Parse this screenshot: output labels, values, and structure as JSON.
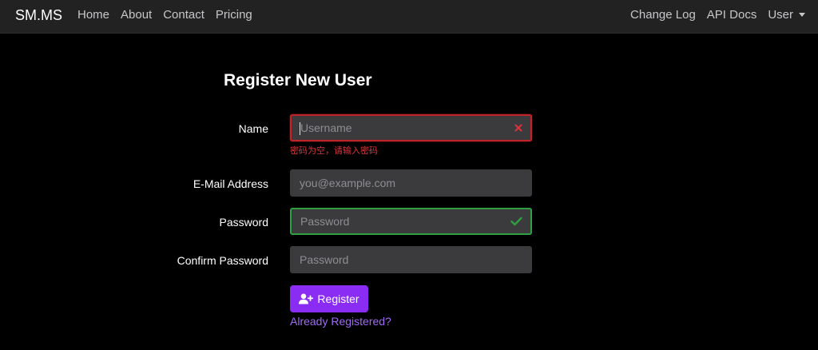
{
  "navbar": {
    "brand": "SM.MS",
    "left_links": [
      {
        "label": "Home"
      },
      {
        "label": "About"
      },
      {
        "label": "Contact"
      },
      {
        "label": "Pricing"
      }
    ],
    "right_links": [
      {
        "label": "Change Log"
      },
      {
        "label": "API Docs"
      },
      {
        "label": "User",
        "dropdown": true
      }
    ]
  },
  "form": {
    "title": "Register New User",
    "fields": [
      {
        "label": "Name",
        "placeholder": "Username",
        "value": "",
        "state": "invalid",
        "error": "密码为空，请输入密码"
      },
      {
        "label": "E-Mail Address",
        "placeholder": "you@example.com",
        "value": "",
        "state": "default"
      },
      {
        "label": "Password",
        "placeholder": "Password",
        "value": "",
        "state": "valid"
      },
      {
        "label": "Confirm Password",
        "placeholder": "Password",
        "value": "",
        "state": "default"
      }
    ],
    "submit_label": "Register",
    "submit_icon": "user-plus-icon",
    "login_link": "Already Registered?"
  },
  "colors": {
    "background": "#000000",
    "navbar": "#222223",
    "input_bg": "#3b3b3d",
    "invalid": "#c1232b",
    "valid": "#2ea043",
    "accent": "#8b2cf5",
    "link": "#a069f5"
  }
}
